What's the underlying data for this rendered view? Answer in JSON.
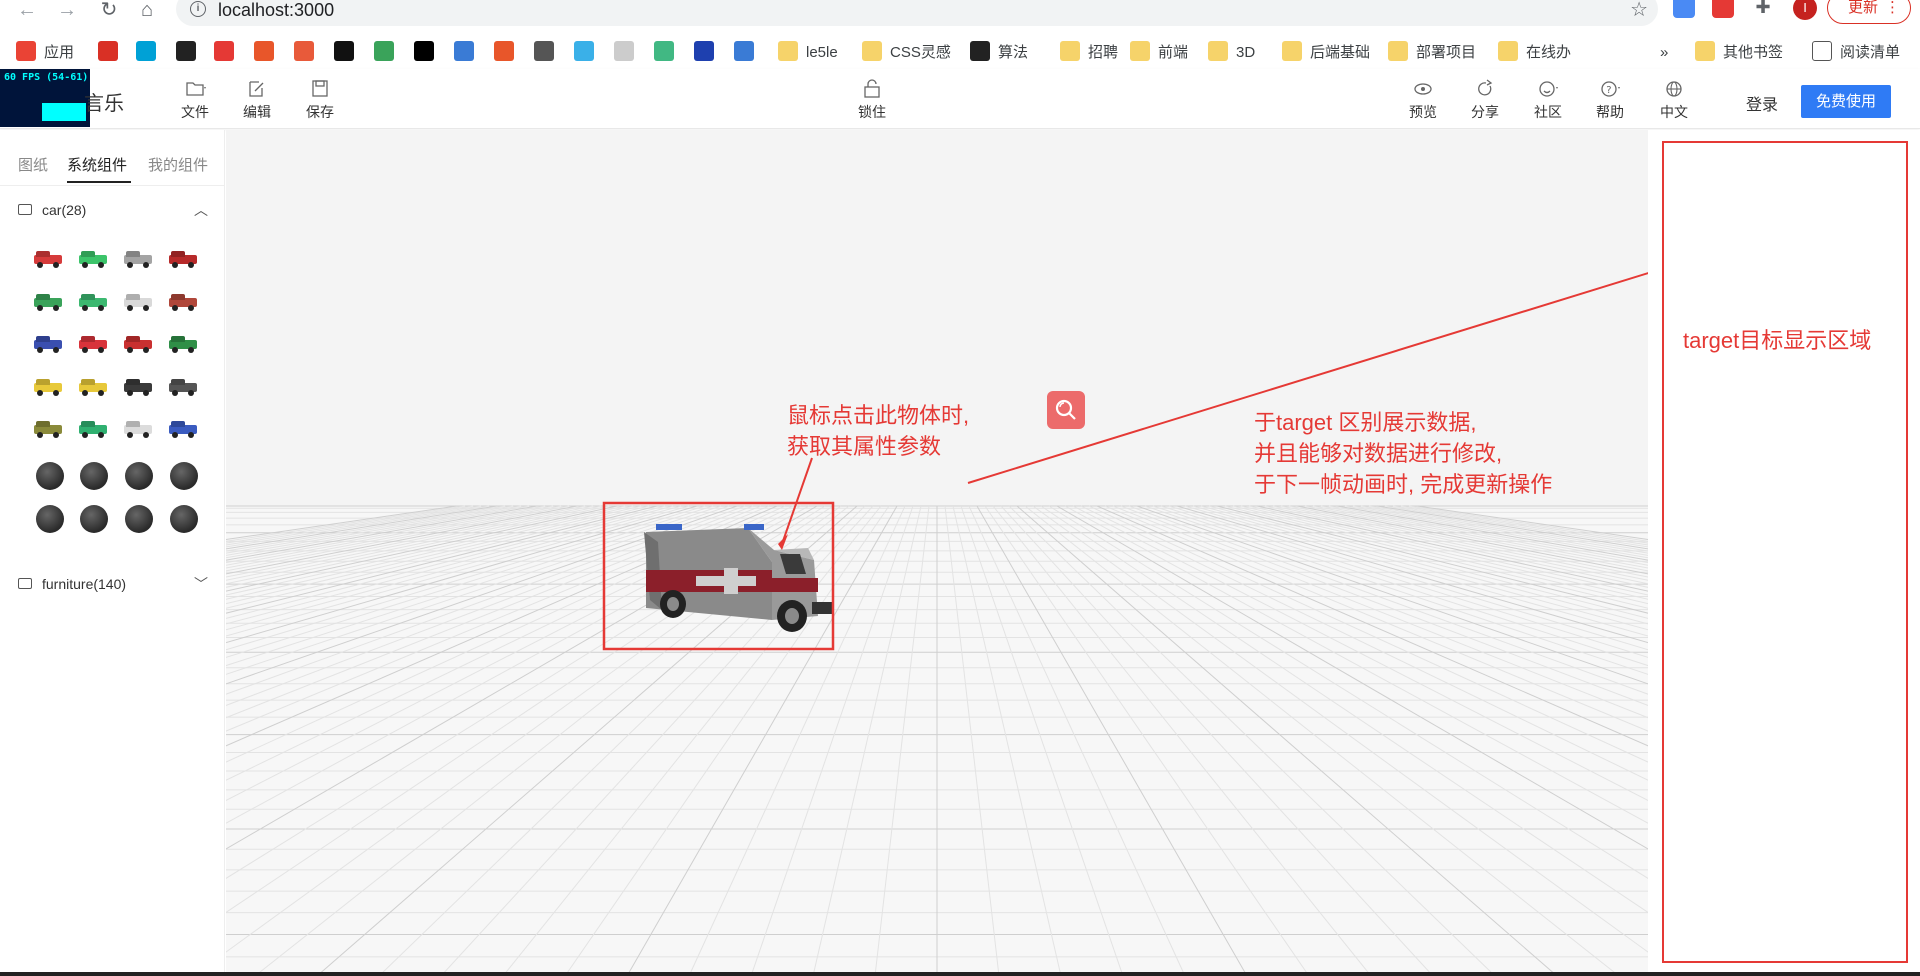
{
  "browser": {
    "url": "localhost:3000",
    "update_label": "更新",
    "profile_initial": "I",
    "bookmarks": [
      {
        "label": "应用",
        "icon": "apps-grid-icon"
      },
      {
        "label": "",
        "icon": "emblem-icon"
      },
      {
        "label": "",
        "icon": "bilibili-icon"
      },
      {
        "label": "",
        "icon": "github-icon"
      },
      {
        "label": "",
        "icon": "g-red-icon"
      },
      {
        "label": "",
        "icon": "c-orange-icon"
      },
      {
        "label": "",
        "icon": "jian-icon"
      },
      {
        "label": "",
        "icon": "dark-square-icon"
      },
      {
        "label": "",
        "icon": "leaf-icon"
      },
      {
        "label": "",
        "icon": "ex-icon"
      },
      {
        "label": "",
        "icon": "bracket-icon"
      },
      {
        "label": "",
        "icon": "c-red-icon"
      },
      {
        "label": "",
        "icon": "feather-icon"
      },
      {
        "label": "",
        "icon": "diamond-icon"
      },
      {
        "label": "",
        "icon": "circle-icon"
      },
      {
        "label": "",
        "icon": "vue-icon"
      },
      {
        "label": "",
        "icon": "b-icon"
      },
      {
        "label": "",
        "icon": "stack-icon"
      },
      {
        "label": "le5le",
        "icon": "folder-icon"
      },
      {
        "label": "CSS灵感",
        "icon": "folder-icon"
      },
      {
        "label": "算法",
        "icon": "d-icon"
      },
      {
        "label": "招聘",
        "icon": "folder-icon"
      },
      {
        "label": "前端",
        "icon": "folder-icon"
      },
      {
        "label": "3D",
        "icon": "folder-icon"
      },
      {
        "label": "后端基础",
        "icon": "folder-icon"
      },
      {
        "label": "部署项目",
        "icon": "folder-icon"
      },
      {
        "label": "在线办",
        "icon": "folder-icon"
      }
    ],
    "more_label": "»",
    "other_bookmarks": "其他书签",
    "reading_list": "阅读清单"
  },
  "app": {
    "fps_text": "60 FPS (54-61)",
    "brand": "言乐",
    "toolbar_left": [
      {
        "label": "文件",
        "icon": "file-icon"
      },
      {
        "label": "编辑",
        "icon": "edit-icon"
      },
      {
        "label": "保存",
        "icon": "save-icon"
      }
    ],
    "lock_label": "锁住",
    "toolbar_right": [
      {
        "label": "预览",
        "icon": "eye-icon"
      },
      {
        "label": "分享",
        "icon": "share-icon"
      },
      {
        "label": "社区",
        "icon": "smile-icon"
      },
      {
        "label": "帮助",
        "icon": "help-icon"
      },
      {
        "label": "中文",
        "icon": "globe-icon"
      }
    ],
    "login": "登录",
    "free_use": "免费使用"
  },
  "sidebar": {
    "tabs": [
      "图纸",
      "系统组件",
      "我的组件"
    ],
    "active_tab": 1,
    "groups": [
      {
        "label": "car(28)",
        "expanded": true
      },
      {
        "label": "furniture(140)",
        "expanded": false
      }
    ],
    "car_colors": [
      "#d63b3b",
      "#3cc46a",
      "#a4a4a4",
      "#b72a2a",
      "#3aa35a",
      "#3cb870",
      "#d9d9d9",
      "#b0473a",
      "#3a4fb0",
      "#d8333b",
      "#c93030",
      "#2f8f47",
      "#e8c93a",
      "#e7c83a",
      "#3a3a3a",
      "#555555",
      "#8a8a3a",
      "#2fb070",
      "#dcdcdc",
      "#3a5bc0"
    ]
  },
  "annotations": {
    "click_note": [
      "鼠标点击此物体时,",
      "获取其属性参数"
    ],
    "target_note": [
      "于target 区别展示数据,",
      "并且能够对数据进行修改,",
      "于下一帧动画时, 完成更新操作"
    ],
    "panel_label": "target目标显示区域"
  }
}
